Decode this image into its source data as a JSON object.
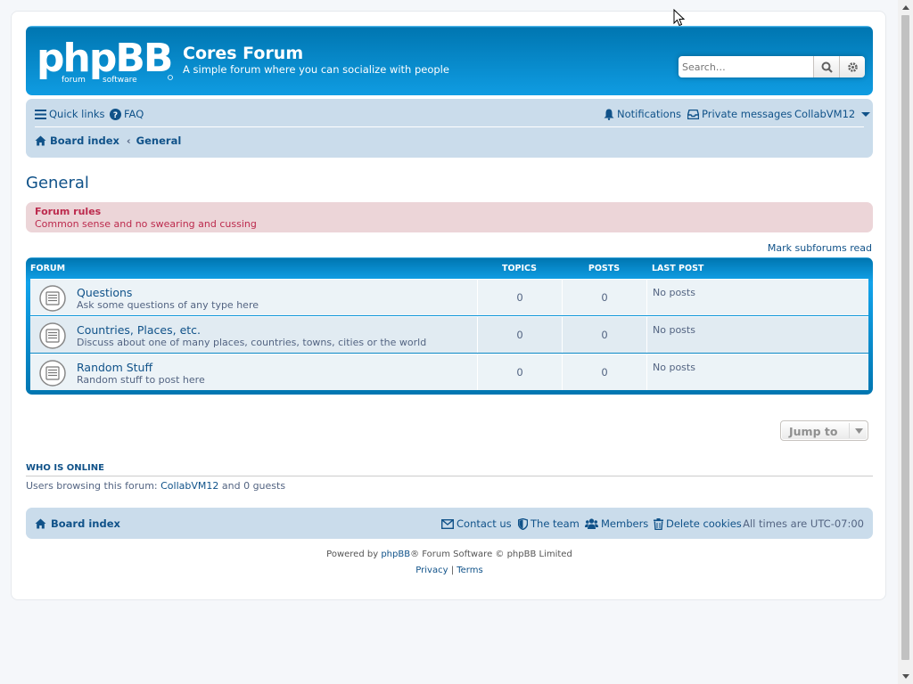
{
  "header": {
    "logo_text": "phpBB",
    "logo_subtext": "forum software",
    "site_title": "Cores Forum",
    "site_description": "A simple forum where you can socialize with people",
    "search_placeholder": "Search…",
    "search_icon": "search-icon",
    "advanced_search_icon": "gear-icon",
    "brand_color": "#12a3eb"
  },
  "navbar": {
    "quick_links": "Quick links",
    "faq": "FAQ",
    "notifications": "Notifications",
    "private_messages": "Private messages",
    "username": "CollabVM12",
    "breadcrumbs": [
      "Board index",
      "General"
    ]
  },
  "page": {
    "title": "General",
    "rules_title": "Forum rules",
    "rules_text": "Common sense and no swearing and cussing",
    "mark_read": "Mark subforums read"
  },
  "forum_table": {
    "headers": {
      "forum": "Forum",
      "topics": "Topics",
      "posts": "Posts",
      "last_post": "Last post"
    },
    "rows": [
      {
        "name": "Questions",
        "description": "Ask some questions of any type here",
        "topics": "0",
        "posts": "0",
        "last_post": "No posts"
      },
      {
        "name": "Countries, Places, etc.",
        "description": "Discuss about one of many places, countries, towns, cities or the world",
        "topics": "0",
        "posts": "0",
        "last_post": "No posts"
      },
      {
        "name": "Random Stuff",
        "description": "Random stuff to post here",
        "topics": "0",
        "posts": "0",
        "last_post": "No posts"
      }
    ]
  },
  "jump_to": "Jump to",
  "online": {
    "title": "Who is online",
    "prefix": "Users browsing this forum: ",
    "user": "CollabVM12",
    "suffix": " and 0 guests"
  },
  "footer": {
    "board_index": "Board index",
    "contact_us": "Contact us",
    "the_team": "The team",
    "members": "Members",
    "delete_cookies": "Delete cookies",
    "timezone": "All times are UTC-07:00",
    "powered_prefix": "Powered by ",
    "powered_link": "phpBB",
    "powered_suffix": "® Forum Software © phpBB Limited",
    "privacy": "Privacy",
    "terms": "Terms",
    "pipe": "|"
  }
}
